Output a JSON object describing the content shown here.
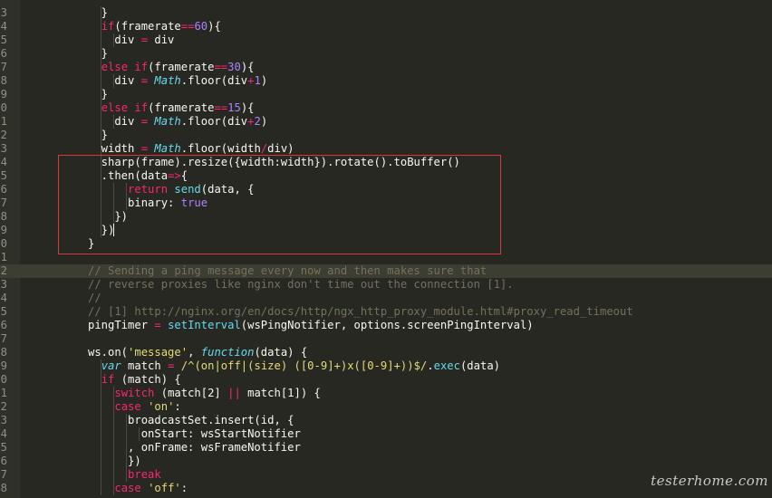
{
  "editor": {
    "theme_colors": {
      "background": "#272822",
      "keyword": "#f92672",
      "number": "#ae81ff",
      "string": "#e6db74",
      "builtin": "#66d9ef",
      "comment": "#75715e",
      "annotation_box": "#d9363e"
    },
    "current_line": 19,
    "lines": [
      {
        "n": "3",
        "indent": 1,
        "tokens": [
          [
            "",
            "  }"
          ]
        ]
      },
      {
        "n": "4",
        "indent": 1,
        "tokens": [
          [
            "",
            "  "
          ],
          [
            "kw",
            "if"
          ],
          [
            "",
            "(framerate"
          ],
          [
            "kw",
            "=="
          ],
          [
            "num",
            "60"
          ],
          [
            "",
            "){"
          ]
        ]
      },
      {
        "n": "5",
        "indent": 2,
        "tokens": [
          [
            "",
            "    div "
          ],
          [
            "kw",
            "="
          ],
          [
            "",
            " div"
          ]
        ]
      },
      {
        "n": "6",
        "indent": 1,
        "tokens": [
          [
            "",
            "  }"
          ]
        ]
      },
      {
        "n": "7",
        "indent": 1,
        "tokens": [
          [
            "",
            "  "
          ],
          [
            "kw",
            "else if"
          ],
          [
            "",
            "(framerate"
          ],
          [
            "kw",
            "=="
          ],
          [
            "num",
            "30"
          ],
          [
            "",
            "){"
          ]
        ]
      },
      {
        "n": "8",
        "indent": 2,
        "tokens": [
          [
            "",
            "    div "
          ],
          [
            "kw",
            "="
          ],
          [
            "",
            " "
          ],
          [
            "fn",
            "Math"
          ],
          [
            "",
            ".floor(div"
          ],
          [
            "kw",
            "+"
          ],
          [
            "num",
            "1"
          ],
          [
            "",
            ")"
          ]
        ]
      },
      {
        "n": "9",
        "indent": 1,
        "tokens": [
          [
            "",
            "  }"
          ]
        ]
      },
      {
        "n": "0",
        "indent": 1,
        "tokens": [
          [
            "",
            "  "
          ],
          [
            "kw",
            "else if"
          ],
          [
            "",
            "(framerate"
          ],
          [
            "kw",
            "=="
          ],
          [
            "num",
            "15"
          ],
          [
            "",
            "){"
          ]
        ]
      },
      {
        "n": "1",
        "indent": 2,
        "tokens": [
          [
            "",
            "    div "
          ],
          [
            "kw",
            "="
          ],
          [
            "",
            " "
          ],
          [
            "fn",
            "Math"
          ],
          [
            "",
            ".floor(div"
          ],
          [
            "kw",
            "+"
          ],
          [
            "num",
            "2"
          ],
          [
            "",
            ")"
          ]
        ]
      },
      {
        "n": "2",
        "indent": 1,
        "tokens": [
          [
            "",
            "  }"
          ]
        ]
      },
      {
        "n": "3",
        "indent": 1,
        "tokens": [
          [
            "",
            "  width "
          ],
          [
            "kw",
            "="
          ],
          [
            "",
            " "
          ],
          [
            "fn",
            "Math"
          ],
          [
            "",
            ".floor(width"
          ],
          [
            "kw",
            "/"
          ],
          [
            "",
            "div)"
          ]
        ]
      },
      {
        "n": "4",
        "indent": 1,
        "tokens": [
          [
            "",
            "  sharp(frame).resize({width:width}).rotate().toBuffer()"
          ]
        ]
      },
      {
        "n": "5",
        "indent": 1,
        "tokens": [
          [
            "",
            "  .then(data"
          ],
          [
            "kw",
            "=>"
          ],
          [
            "",
            "{"
          ]
        ]
      },
      {
        "n": "6",
        "indent": 3,
        "tokens": [
          [
            "",
            "      "
          ],
          [
            "kw",
            "return"
          ],
          [
            "",
            " "
          ],
          [
            "cl",
            "send"
          ],
          [
            "",
            "(data, {"
          ]
        ]
      },
      {
        "n": "7",
        "indent": 3,
        "tokens": [
          [
            "",
            "      binary: "
          ],
          [
            "num",
            "true"
          ]
        ]
      },
      {
        "n": "8",
        "indent": 2,
        "tokens": [
          [
            "",
            "    })"
          ]
        ]
      },
      {
        "n": "9",
        "indent": 1,
        "tokens": [
          [
            "",
            "  })"
          ]
        ]
      },
      {
        "n": "0",
        "indent": 0,
        "tokens": [
          [
            "",
            "}"
          ]
        ]
      },
      {
        "n": "1",
        "indent": 0,
        "tokens": []
      },
      {
        "n": "2",
        "indent": 0,
        "tokens": [
          [
            "cm",
            "// Sending a ping message every now and then makes sure that"
          ]
        ]
      },
      {
        "n": "3",
        "indent": 0,
        "tokens": [
          [
            "cm",
            "// reverse proxies like nginx don't time out the connection [1]."
          ]
        ]
      },
      {
        "n": "4",
        "indent": 0,
        "tokens": [
          [
            "cm",
            "//"
          ]
        ]
      },
      {
        "n": "5",
        "indent": 0,
        "tokens": [
          [
            "cm",
            "// [1] http://nginx.org/en/docs/http/ngx_http_proxy_module.html#proxy_read_timeout"
          ]
        ]
      },
      {
        "n": "6",
        "indent": 0,
        "tokens": [
          [
            "",
            "pingTimer "
          ],
          [
            "kw",
            "="
          ],
          [
            "",
            " "
          ],
          [
            "cl",
            "setInterval"
          ],
          [
            "",
            "(wsPingNotifier, options.screenPingInterval)"
          ]
        ]
      },
      {
        "n": "7",
        "indent": 0,
        "tokens": []
      },
      {
        "n": "8",
        "indent": 0,
        "tokens": [
          [
            "",
            "ws.on("
          ],
          [
            "str",
            "'message'"
          ],
          [
            "",
            ", "
          ],
          [
            "fn",
            "function"
          ],
          [
            "",
            "(data) {"
          ]
        ]
      },
      {
        "n": "9",
        "indent": 1,
        "tokens": [
          [
            "",
            "  "
          ],
          [
            "fn",
            "var"
          ],
          [
            "",
            " match "
          ],
          [
            "kw",
            "="
          ],
          [
            "",
            " "
          ],
          [
            "str",
            "/^(on|off|(size) ([0-9]+)x([0-9]+))$/"
          ],
          [
            "",
            "."
          ],
          [
            "cl",
            "exec"
          ],
          [
            "",
            "(data)"
          ]
        ]
      },
      {
        "n": "0",
        "indent": 1,
        "tokens": [
          [
            "",
            "  "
          ],
          [
            "kw",
            "if"
          ],
          [
            "",
            " (match) {"
          ]
        ]
      },
      {
        "n": "1",
        "indent": 2,
        "tokens": [
          [
            "",
            "    "
          ],
          [
            "kw",
            "switch"
          ],
          [
            "",
            " (match[2] "
          ],
          [
            "kw",
            "||"
          ],
          [
            "",
            " match[1]) {"
          ]
        ]
      },
      {
        "n": "2",
        "indent": 2,
        "tokens": [
          [
            "",
            "    "
          ],
          [
            "kw",
            "case"
          ],
          [
            "",
            " "
          ],
          [
            "str",
            "'on'"
          ],
          [
            "",
            ":"
          ]
        ]
      },
      {
        "n": "3",
        "indent": 3,
        "tokens": [
          [
            "",
            "      broadcastSet.insert(id, {"
          ]
        ]
      },
      {
        "n": "4",
        "indent": 4,
        "tokens": [
          [
            "",
            "        onStart: wsStartNotifier"
          ]
        ]
      },
      {
        "n": "5",
        "indent": 3,
        "tokens": [
          [
            "",
            "      , onFrame: wsFrameNotifier"
          ]
        ]
      },
      {
        "n": "6",
        "indent": 3,
        "tokens": [
          [
            "",
            "      })"
          ]
        ]
      },
      {
        "n": "7",
        "indent": 3,
        "tokens": [
          [
            "",
            "      "
          ],
          [
            "kw",
            "break"
          ]
        ]
      },
      {
        "n": "8",
        "indent": 2,
        "tokens": [
          [
            "",
            "    "
          ],
          [
            "kw",
            "case"
          ],
          [
            "",
            " "
          ],
          [
            "str",
            "'off'"
          ],
          [
            "",
            ":"
          ]
        ]
      }
    ]
  },
  "watermark": "testerhome.com"
}
